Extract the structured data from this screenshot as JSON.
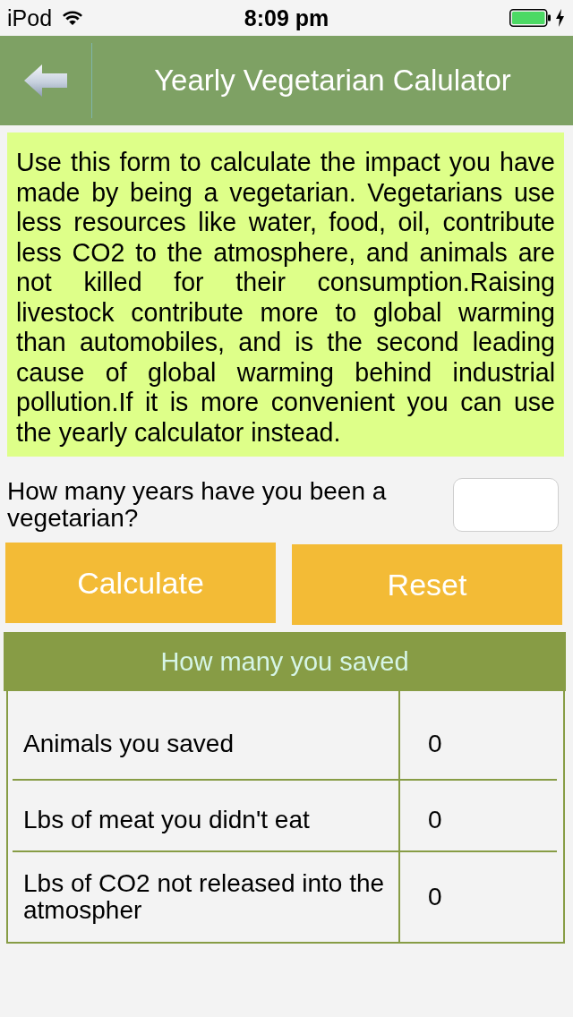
{
  "status_bar": {
    "carrier": "iPod",
    "time": "8:09 pm"
  },
  "nav_bar": {
    "title": "Yearly Vegetarian Calulator"
  },
  "description": "Use this form to calculate the impact you have made by being a vegetarian. Vegetarians use less resources like water, food, oil, contribute less CO2 to the atmosphere, and animals are not killed for their consumption.Raising livestock contribute more to global warming than automobiles, and is the second leading cause of global warming behind industrial pollution.If it is more convenient you can use the yearly calculator instead.",
  "question": {
    "label": "How many years have you been a vegetarian?"
  },
  "buttons": [
    {
      "label": "Calculate"
    },
    {
      "label": "Reset"
    }
  ],
  "results": {
    "title": "How many you saved",
    "rows": [
      {
        "label": "Animals you saved",
        "value": "0"
      },
      {
        "label": "Lbs of meat you didn't eat",
        "value": "0"
      },
      {
        "label": "Lbs of CO2 not released into the atmospher",
        "value": "0"
      }
    ]
  }
}
